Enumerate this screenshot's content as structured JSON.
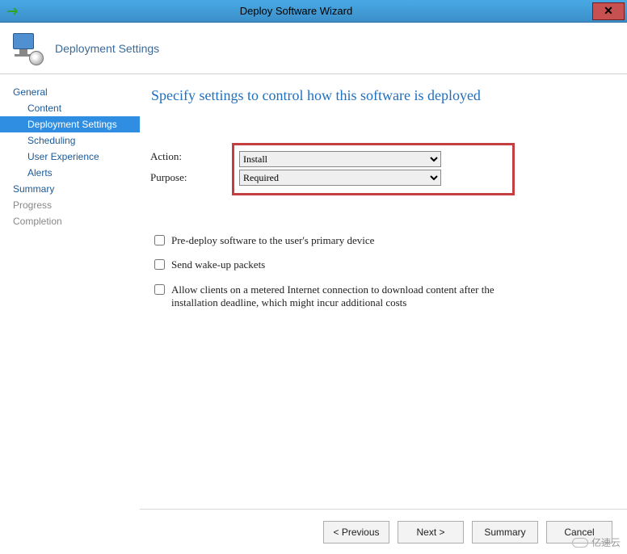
{
  "window": {
    "title": "Deploy Software Wizard"
  },
  "header": {
    "page_title": "Deployment Settings"
  },
  "sidebar": {
    "groups": [
      {
        "label": "General",
        "muted": false
      },
      {
        "label": "Summary",
        "muted": false
      },
      {
        "label": "Progress",
        "muted": true
      },
      {
        "label": "Completion",
        "muted": true
      }
    ],
    "items": [
      {
        "label": "Content"
      },
      {
        "label": "Deployment Settings"
      },
      {
        "label": "Scheduling"
      },
      {
        "label": "User Experience"
      },
      {
        "label": "Alerts"
      }
    ],
    "selected": "Deployment Settings"
  },
  "content": {
    "heading": "Specify settings to control how this software is deployed",
    "action_label": "Action:",
    "purpose_label": "Purpose:",
    "action_value": "Install",
    "purpose_value": "Required",
    "action_options": [
      "Install"
    ],
    "purpose_options": [
      "Required"
    ],
    "checkboxes": {
      "predeploy": "Pre-deploy software to the user's primary device",
      "wakeup": "Send wake-up packets",
      "metered": "Allow clients on a metered Internet connection to download content after the installation deadline, which might incur additional costs"
    }
  },
  "footer": {
    "previous": "< Previous",
    "next": "Next >",
    "summary": "Summary",
    "cancel": "Cancel"
  },
  "watermark": "亿速云"
}
